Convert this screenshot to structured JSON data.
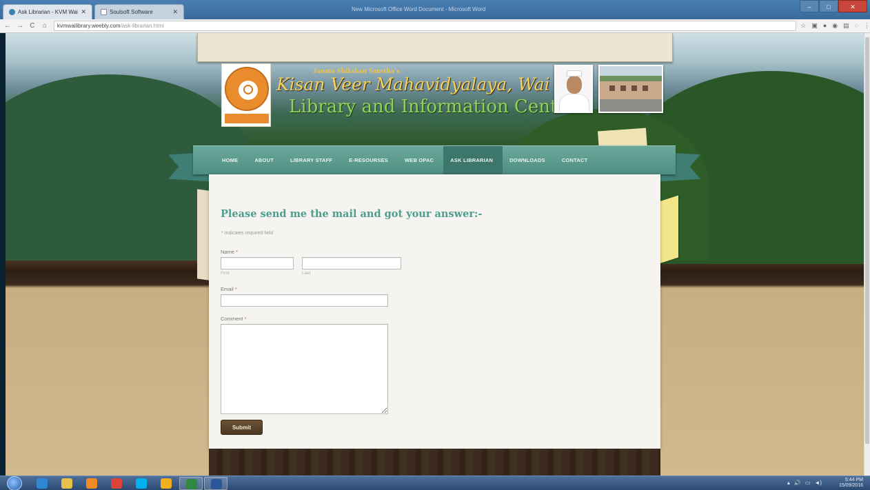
{
  "browser": {
    "tabs": [
      {
        "label": "Ask Librarian - KVM Wai"
      },
      {
        "label": "Soulsoft Software"
      }
    ],
    "window_title": "New Microsoft Office Word Document - Microsoft Word",
    "controls": {
      "minimize": "–",
      "maximize": "□",
      "close": "✕"
    },
    "nav": {
      "back": "←",
      "forward": "→",
      "reload": "C",
      "home": "⌂"
    },
    "url_host": "kvmwailibrary.weebly.com",
    "url_path": "/ask-librarian.html",
    "extension_icons": [
      "☆",
      "▣",
      "●",
      "◉",
      "▤",
      "◌",
      "⋮"
    ]
  },
  "header": {
    "org": "Janata Shikshan Sanstha's",
    "college": "Kisan Veer Mahavidyalaya, Wai",
    "centre": "Library and Information Centre"
  },
  "nav": {
    "items": [
      {
        "label": "HOME"
      },
      {
        "label": "ABOUT"
      },
      {
        "label": "LIBRARY STAFF"
      },
      {
        "label": "E-RESOURSES"
      },
      {
        "label": "WEB OPAC"
      },
      {
        "label": "ASK LIBRARIAN",
        "active": true
      },
      {
        "label": "DOWNLOADS"
      },
      {
        "label": "CONTACT"
      }
    ]
  },
  "form": {
    "title": "Please send me the mail and got your answer:-",
    "required_note": "* Indicates required field",
    "name_label": "Name",
    "first_sub": "First",
    "last_sub": "Last",
    "email_label": "Email",
    "comment_label": "Comment",
    "required_mark": "*",
    "first_value": "",
    "last_value": "",
    "email_value": "",
    "comment_value": "",
    "submit_label": "Submit"
  },
  "taskbar": {
    "time": "5:44 PM",
    "date": "15/09/2016",
    "tray_icons": [
      "▴",
      "🔊",
      "▭",
      "◄)"
    ],
    "apps": [
      {
        "name": "internet-explorer",
        "color": "#2f86d3"
      },
      {
        "name": "file-explorer",
        "color": "#e8c14b"
      },
      {
        "name": "media-player",
        "color": "#f08a24"
      },
      {
        "name": "chrome",
        "color": "#db4437"
      },
      {
        "name": "skype",
        "color": "#00aff0"
      },
      {
        "name": "paint",
        "color": "#f2b01e"
      },
      {
        "name": "spreadsheet",
        "color": "#2d8a3e"
      },
      {
        "name": "word",
        "color": "#2b579a"
      }
    ]
  }
}
